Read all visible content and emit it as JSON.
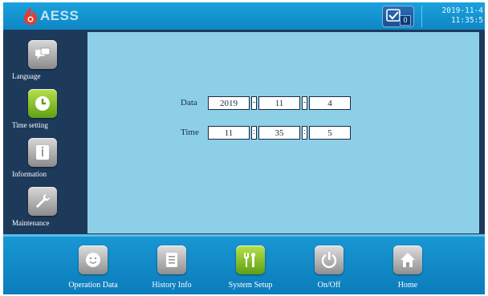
{
  "header": {
    "brand": "AESS",
    "status_count": "0",
    "date": "2019-11-4",
    "time": "11:35:5"
  },
  "sidebar": {
    "items": [
      {
        "label": "Language",
        "icon": "chat-icon",
        "active": false
      },
      {
        "label": "Time setting",
        "icon": "clock-icon",
        "active": true
      },
      {
        "label": "Information",
        "icon": "info-icon",
        "active": false
      },
      {
        "label": "Maintenance",
        "icon": "wrench-icon",
        "active": false
      }
    ]
  },
  "form": {
    "date_label": "Data",
    "year": "2019",
    "month": "11",
    "day": "4",
    "date_sep1": "-",
    "date_sep2": "-",
    "time_label": "Time",
    "hour": "11",
    "minute": "35",
    "second": "5",
    "time_sep1": ":",
    "time_sep2": ":"
  },
  "bottom_nav": {
    "items": [
      {
        "label": "Operation Data",
        "icon": "smiley-icon",
        "active": false
      },
      {
        "label": "History Info",
        "icon": "document-icon",
        "active": false
      },
      {
        "label": "System Setup",
        "icon": "tools-icon",
        "active": true
      },
      {
        "label": "On/Off",
        "icon": "power-icon",
        "active": false
      },
      {
        "label": "Home",
        "icon": "home-icon",
        "active": false
      }
    ]
  },
  "colors": {
    "header": "#1aa2dc",
    "panel": "#8ecfe8",
    "frame": "#1d3a5b",
    "active": "#7cc22a",
    "logo": "#e63c2f"
  }
}
